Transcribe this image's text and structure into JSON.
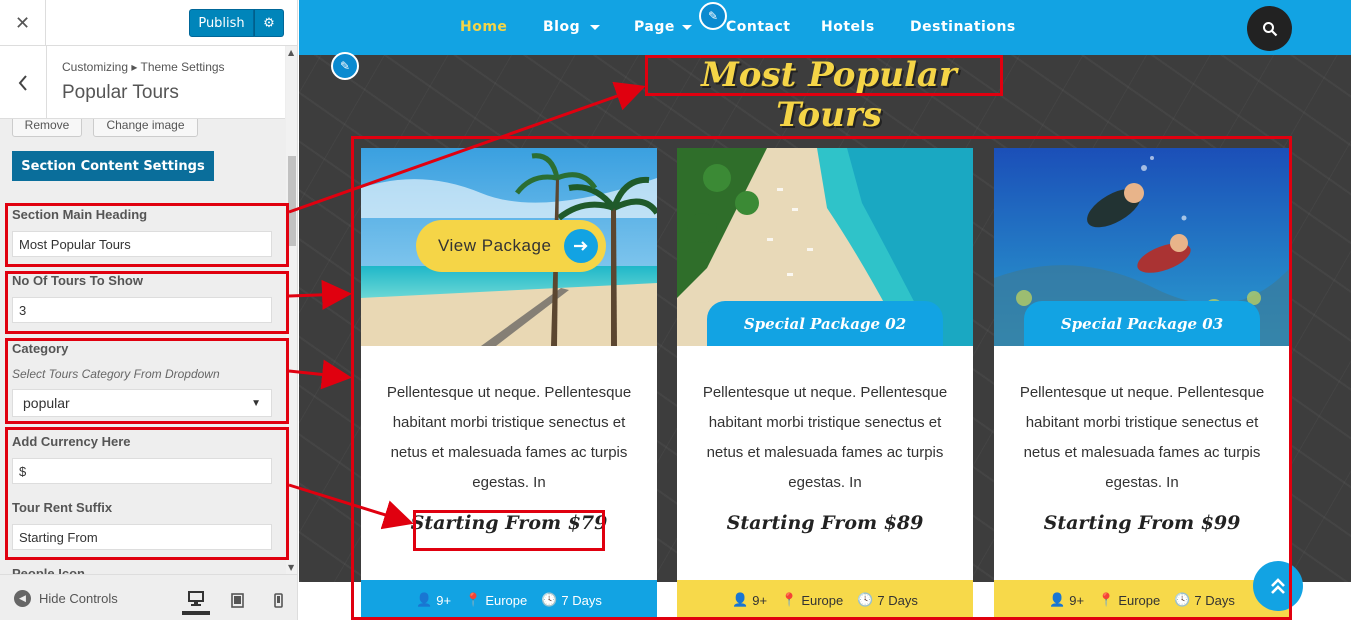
{
  "customizer": {
    "close_icon": "close-icon",
    "publish_label": "Publish",
    "breadcrumb": "Customizing ▸ Theme Settings",
    "section_title": "Popular Tours",
    "remove_label": "Remove",
    "change_image_label": "Change image",
    "section_content_label": "Section Content Settings",
    "controls": {
      "main_heading": {
        "label": "Section Main Heading",
        "value": "Most Popular Tours"
      },
      "tours_count": {
        "label": "No Of Tours To Show",
        "value": "3"
      },
      "category": {
        "label": "Category",
        "description": "Select Tours Category From Dropdown",
        "value": "popular"
      },
      "currency": {
        "label": "Add Currency Here",
        "value": "$"
      },
      "rent_suffix": {
        "label": "Tour Rent Suffix",
        "value": "Starting From"
      },
      "people_icon": {
        "label": "People Icon"
      }
    },
    "hide_controls_label": "Hide Controls"
  },
  "nav": {
    "items": [
      "Home",
      "Blog",
      "Page",
      "Contact",
      "Hotels",
      "Destinations"
    ],
    "active": "Home"
  },
  "section": {
    "heading": "Most Popular Tours",
    "view_package_label": "View Package",
    "cards": [
      {
        "title": "",
        "text": "Pellentesque ut neque. Pellentesque habitant morbi tristique senectus et netus et malesuada fames ac turpis egestas. In",
        "price": "Starting From $79",
        "people": "9+",
        "location": "Europe",
        "duration": "7 Days",
        "footer_color": "#12a3e3"
      },
      {
        "title": "Special Package 02",
        "text": "Pellentesque ut neque. Pellentesque habitant morbi tristique senectus et netus et malesuada fames ac turpis egestas. In",
        "price": "Starting From $89",
        "people": "9+",
        "location": "Europe",
        "duration": "7 Days",
        "footer_color": "#f7d94a"
      },
      {
        "title": "Special Package 03",
        "text": "Pellentesque ut neque. Pellentesque habitant morbi tristique senectus et netus et malesuada fames ac turpis egestas. In",
        "price": "Starting From $99",
        "people": "9+",
        "location": "Europe",
        "duration": "7 Days",
        "footer_color": "#f7d94a"
      }
    ]
  },
  "colors": {
    "primary_blue": "#12a3e3",
    "accent_yellow": "#f5d547",
    "annotation_red": "#e0000f",
    "wp_blue": "#0085ba"
  }
}
